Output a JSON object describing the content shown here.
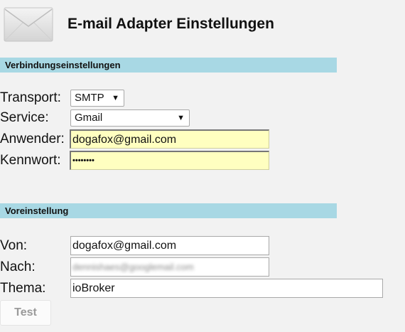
{
  "header": {
    "title": "E-mail Adapter Einstellungen",
    "icon": "envelope-icon"
  },
  "connection": {
    "section_title": "Verbindungseinstellungen",
    "transport_label": "Transport:",
    "transport_value": "SMTP",
    "service_label": "Service:",
    "service_value": "Gmail",
    "user_label": "Anwender:",
    "user_value": "dogafox@gmail.com",
    "password_label": "Kennwort:",
    "password_value": "••••••••"
  },
  "defaults": {
    "section_title": "Voreinstellung",
    "from_label": "Von:",
    "from_value": "dogafox@gmail.com",
    "to_label": "Nach:",
    "to_value": "dennishaes@googlemail.com",
    "subject_label": "Thema:",
    "subject_value": "ioBroker"
  },
  "actions": {
    "test_label": "Test"
  },
  "colors": {
    "section_bar": "#a8d8e4",
    "autofill_yellow": "#ffffc0",
    "background": "#f2f2f2"
  }
}
